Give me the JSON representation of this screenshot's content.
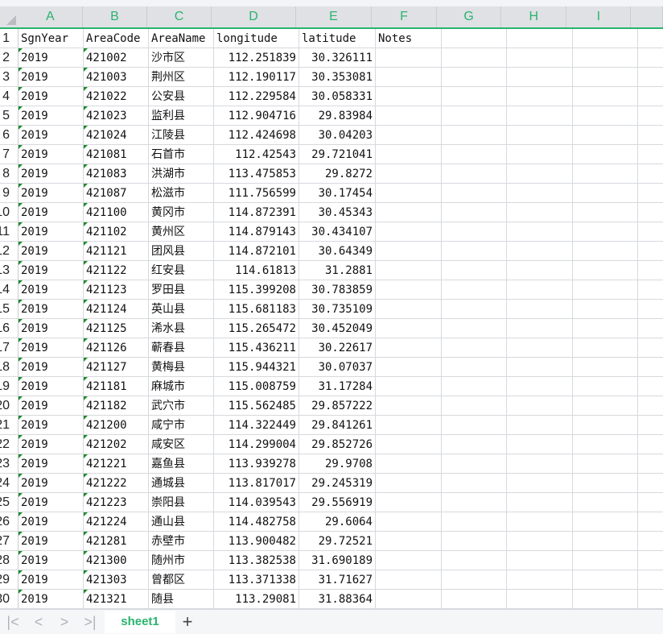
{
  "columns": [
    "A",
    "B",
    "C",
    "D",
    "E",
    "F",
    "G",
    "H",
    "I",
    ""
  ],
  "rows": [
    [
      "SgnYear",
      "AreaCode",
      "AreaName",
      "longitude",
      "latitude",
      "Notes"
    ],
    [
      "2019",
      "421002",
      "沙市区",
      "112.251839",
      "30.326111"
    ],
    [
      "2019",
      "421003",
      "荆州区",
      "112.190117",
      "30.353081"
    ],
    [
      "2019",
      "421022",
      "公安县",
      "112.229584",
      "30.058331"
    ],
    [
      "2019",
      "421023",
      "监利县",
      "112.904716",
      "29.83984"
    ],
    [
      "2019",
      "421024",
      "江陵县",
      "112.424698",
      "30.04203"
    ],
    [
      "2019",
      "421081",
      "石首市",
      "112.42543",
      "29.721041"
    ],
    [
      "2019",
      "421083",
      "洪湖市",
      "113.475853",
      "29.8272"
    ],
    [
      "2019",
      "421087",
      "松滋市",
      "111.756599",
      "30.17454"
    ],
    [
      "2019",
      "421100",
      "黄冈市",
      "114.872391",
      "30.45343"
    ],
    [
      "2019",
      "421102",
      "黄州区",
      "114.879143",
      "30.434107"
    ],
    [
      "2019",
      "421121",
      "团风县",
      "114.872101",
      "30.64349"
    ],
    [
      "2019",
      "421122",
      "红安县",
      "114.61813",
      "31.2881"
    ],
    [
      "2019",
      "421123",
      "罗田县",
      "115.399208",
      "30.783859"
    ],
    [
      "2019",
      "421124",
      "英山县",
      "115.681183",
      "30.735109"
    ],
    [
      "2019",
      "421125",
      "浠水县",
      "115.265472",
      "30.452049"
    ],
    [
      "2019",
      "421126",
      "蕲春县",
      "115.436211",
      "30.22617"
    ],
    [
      "2019",
      "421127",
      "黄梅县",
      "115.944321",
      "30.07037"
    ],
    [
      "2019",
      "421181",
      "麻城市",
      "115.008759",
      "31.17284"
    ],
    [
      "2019",
      "421182",
      "武穴市",
      "115.562485",
      "29.857222"
    ],
    [
      "2019",
      "421200",
      "咸宁市",
      "114.322449",
      "29.841261"
    ],
    [
      "2019",
      "421202",
      "咸安区",
      "114.299004",
      "29.852726"
    ],
    [
      "2019",
      "421221",
      "嘉鱼县",
      "113.939278",
      "29.9708"
    ],
    [
      "2019",
      "421222",
      "通城县",
      "113.817017",
      "29.245319"
    ],
    [
      "2019",
      "421223",
      "崇阳县",
      "114.039543",
      "29.556919"
    ],
    [
      "2019",
      "421224",
      "通山县",
      "114.482758",
      "29.6064"
    ],
    [
      "2019",
      "421281",
      "赤壁市",
      "113.900482",
      "29.72521"
    ],
    [
      "2019",
      "421300",
      "随州市",
      "113.382538",
      "31.690189"
    ],
    [
      "2019",
      "421303",
      "曾都区",
      "113.371338",
      "31.71627"
    ],
    [
      "2019",
      "421321",
      "随县",
      "113.29081",
      "31.88364"
    ]
  ],
  "row_numbers": [
    "1",
    "2",
    "3",
    "4",
    "5",
    "6",
    "7",
    "8",
    "9",
    "10",
    "11",
    "12",
    "13",
    "14",
    "15",
    "16",
    "17",
    "18",
    "19",
    "20",
    "21",
    "22",
    "23",
    "24",
    "25",
    "26",
    "27",
    "28",
    "29",
    "30"
  ],
  "tabbar": {
    "nav_first": "|<",
    "nav_prev": "<",
    "nav_next": ">",
    "nav_last": ">|",
    "sheet_tab": "sheet1",
    "add_sheet": "+"
  }
}
